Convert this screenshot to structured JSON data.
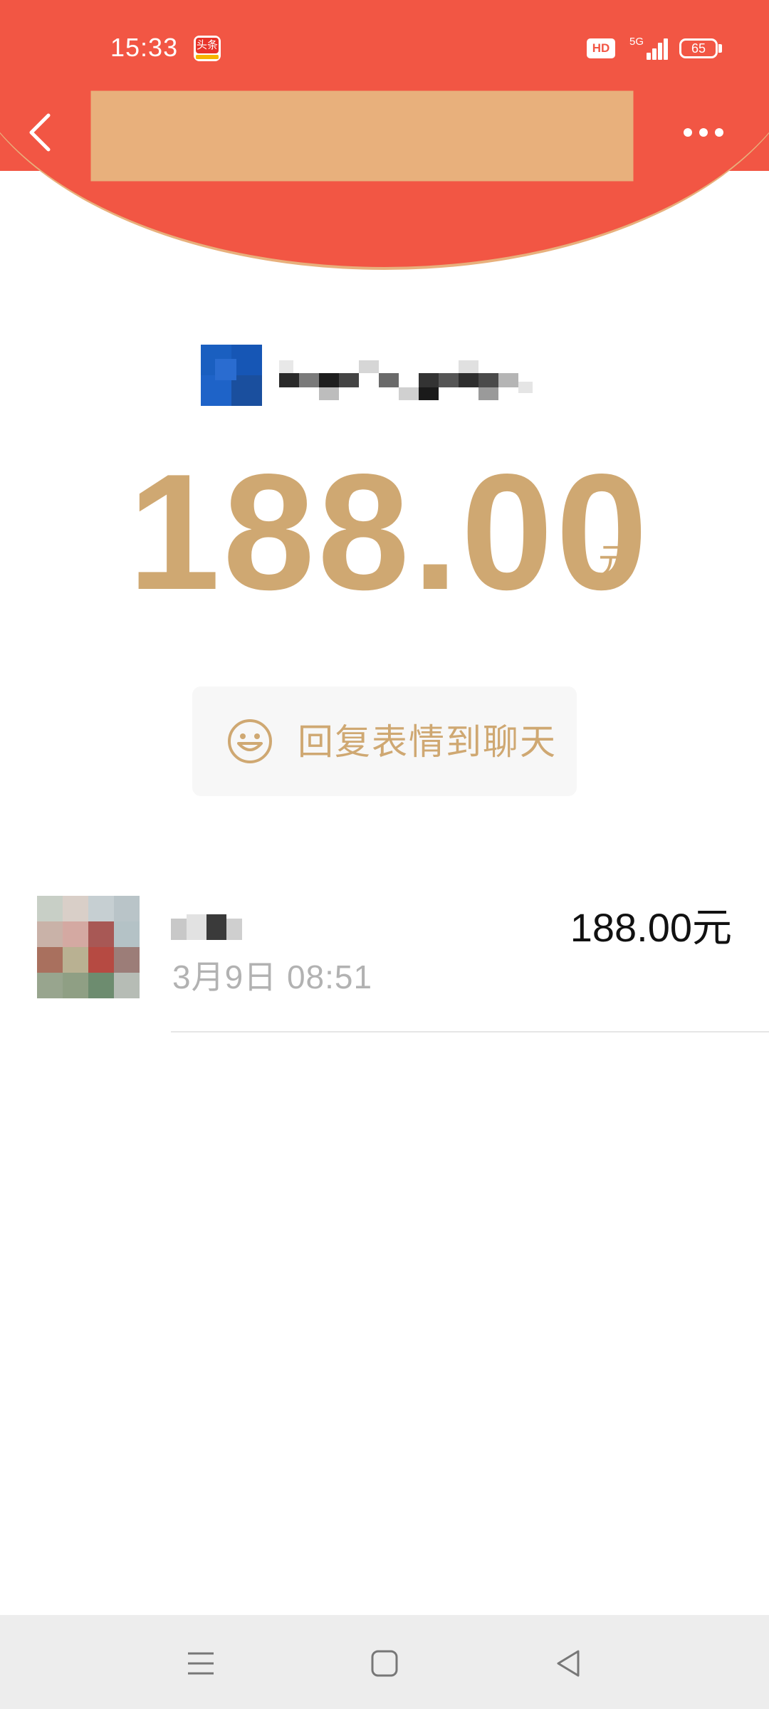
{
  "status_bar": {
    "time": "15:33",
    "app_badge_text": "头条",
    "hd_label": "HD",
    "network": "5G",
    "battery": "65"
  },
  "header": {
    "color": "#F25644",
    "back_icon": "chevron-left-icon",
    "more_icon": "more-dots-icon"
  },
  "packet": {
    "amount": "188.00",
    "unit": "元",
    "accent_color": "#CFA872",
    "reply_label": "回复表情到聊天",
    "reply_icon": "smiley-icon"
  },
  "records": [
    {
      "time": "3月9日  08:51",
      "amount": "188.00元"
    }
  ],
  "navbar": {
    "menu_icon": "menu-icon",
    "home_icon": "home-square-icon",
    "back_icon": "back-triangle-icon"
  }
}
